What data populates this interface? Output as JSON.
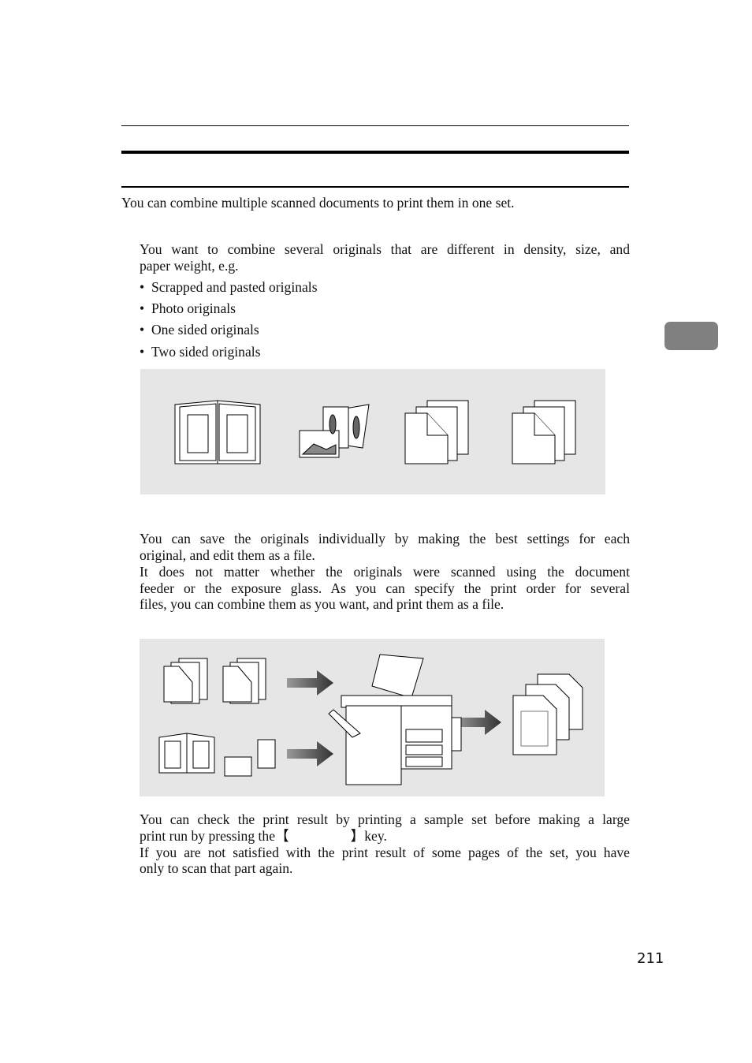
{
  "intro": "You can combine multiple scanned documents to print them in one set.",
  "section1": {
    "para_line1": "You want to combine several originals that are different in density, size, and",
    "para_line2": "paper weight, e.g.",
    "bullets": [
      "Scrapped and pasted originals",
      "Photo originals",
      "One sided originals",
      "Two sided originals"
    ]
  },
  "section2": {
    "lines": [
      "You can save the originals individually by making the best settings for each",
      "original, and edit them as a file.",
      "It does not matter whether the originals were scanned using the document",
      "feeder or the exposure glass. As you can specify the print order for several",
      "files, you can combine them as you want, and print them as a file."
    ]
  },
  "section3": {
    "line1": "You can check the print result by printing a sample set before making a large",
    "line2_before": "print run by pressing the",
    "key_open": "【",
    "key_close": "】",
    "line2_after": "key.",
    "line3": "If you are not satisfied with the print result of some pages of the set, you have",
    "line4": "only to scan that part again."
  },
  "figure_bg_color": "#e6e6e6",
  "tab_color": "#808080",
  "page_number": "211"
}
